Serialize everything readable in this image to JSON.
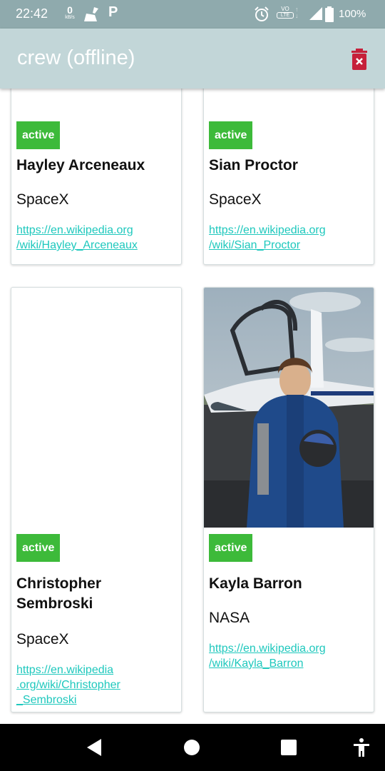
{
  "status_bar": {
    "time": "22:42",
    "net_speed_value": "0",
    "net_speed_unit": "kB/s",
    "p_label": "P",
    "volte_top": "VO",
    "volte_bottom": "LTE",
    "battery": "100%"
  },
  "app_bar": {
    "title": "crew (offline)"
  },
  "cards": [
    {
      "status": "active",
      "name_lines": [
        "Hayley Arceneaux"
      ],
      "agency": "SpaceX",
      "link_lines": [
        "https://en.wikipedia.org",
        "/wiki/Hayley_Arceneaux"
      ]
    },
    {
      "status": "active",
      "name_lines": [
        "Sian Proctor"
      ],
      "agency": "SpaceX",
      "link_lines": [
        "https://en.wikipedia.org",
        "/wiki/Sian_Proctor"
      ]
    },
    {
      "status": "active",
      "name_lines": [
        "Christopher",
        "Sembroski"
      ],
      "agency": "SpaceX",
      "link_lines": [
        "https://en.wikipedia",
        ".org/wiki/Christopher",
        "_Sembroski"
      ]
    },
    {
      "status": "active",
      "name_lines": [
        "Kayla Barron"
      ],
      "agency": "NASA",
      "link_lines": [
        "https://en.wikipedia.org",
        "/wiki/Kayla_Barron"
      ]
    }
  ],
  "icons": {
    "status": [
      "broom-icon",
      "parking-icon",
      "alarm-icon",
      "signal-icon",
      "battery-icon"
    ],
    "app_bar": [
      "delete-icon"
    ],
    "nav": [
      "back-icon",
      "home-icon",
      "recents-icon",
      "accessibility-icon"
    ]
  },
  "colors": {
    "status_bar": "#8faaad",
    "app_bar": "#c2d6d8",
    "badge": "#3dba3a",
    "link": "#1ec8bd",
    "delete": "#c6203a"
  }
}
